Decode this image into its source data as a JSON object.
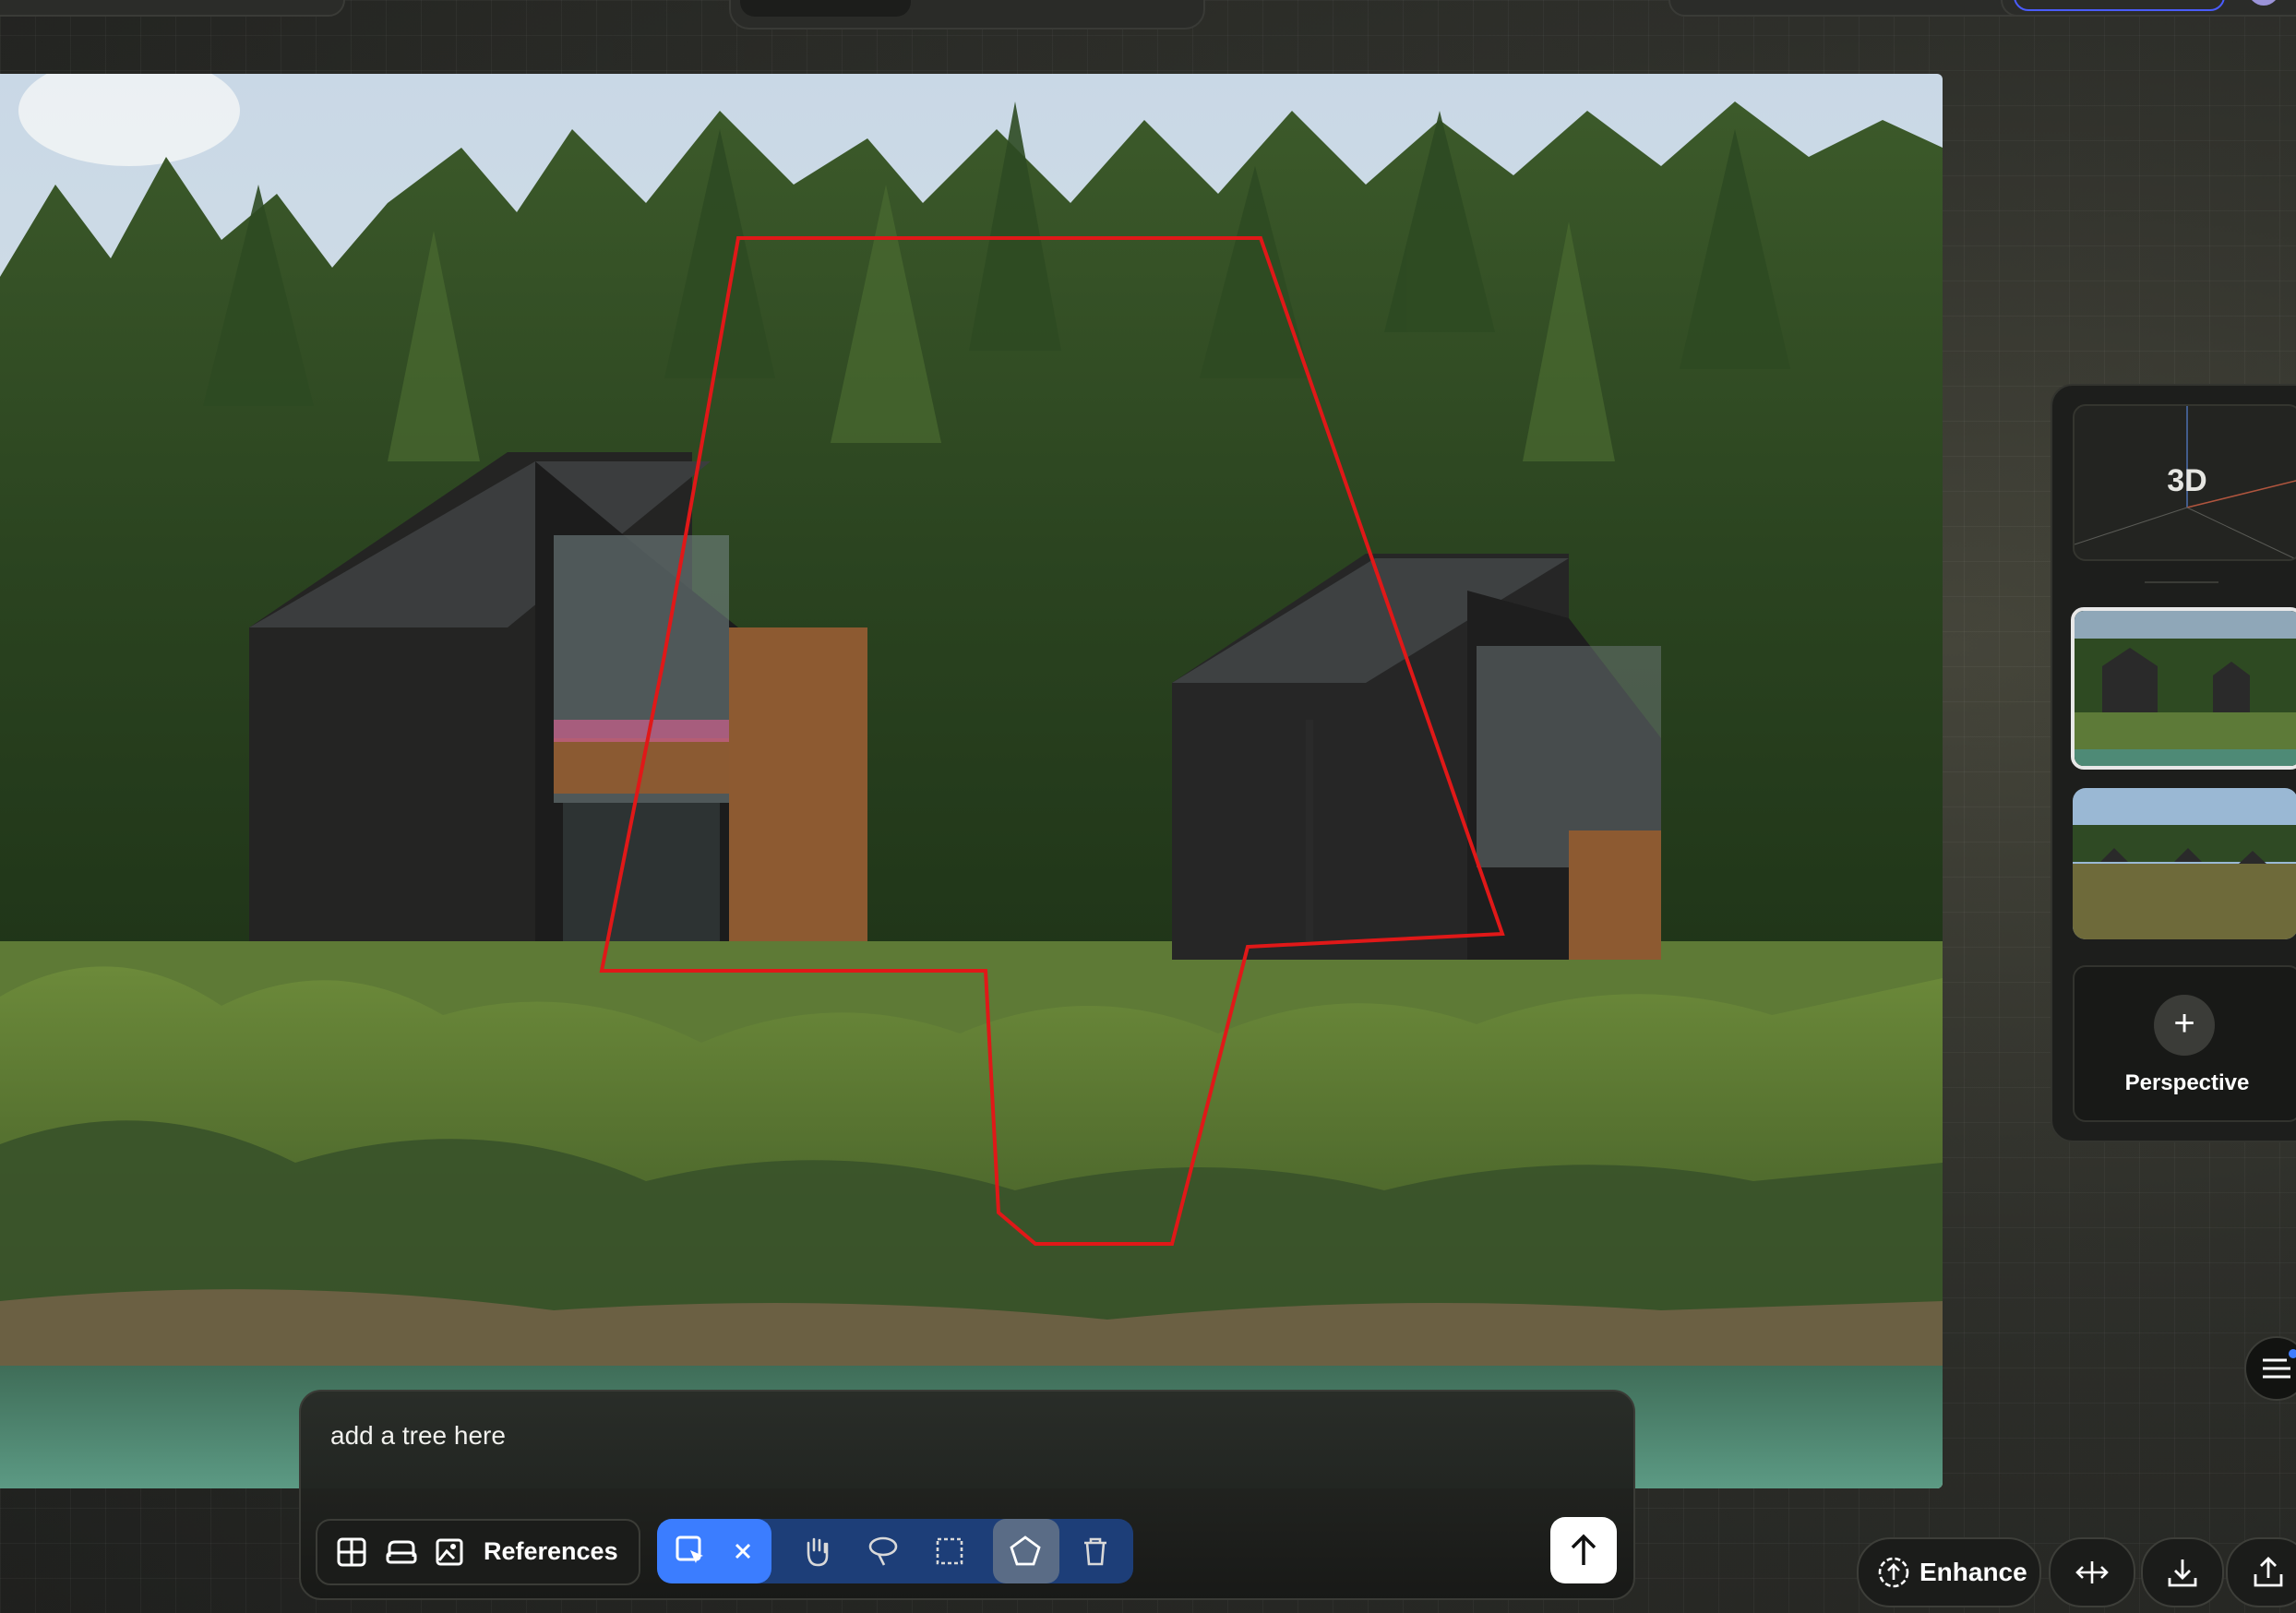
{
  "canvas": {
    "image_description": ""
  },
  "side_panel": {
    "card_3d_label": "3D",
    "add_perspective_label": "Perspective"
  },
  "prompt": {
    "text": "add a tree here",
    "references_label": "References"
  },
  "actions": {
    "enhance_label": "Enhance"
  },
  "colors": {
    "accent_blue": "#3b7dff",
    "mask_outline": "#e01818"
  },
  "icons": [
    "grid-icon",
    "sofa-icon",
    "image-upload-icon",
    "select-cursor-icon",
    "close-icon",
    "hand-icon",
    "lasso-icon",
    "rect-select-icon",
    "polygon-icon",
    "trash-icon",
    "arrow-up-icon",
    "enhance-icon",
    "move-icon",
    "download-icon",
    "share-icon",
    "list-icon",
    "plus-icon"
  ]
}
